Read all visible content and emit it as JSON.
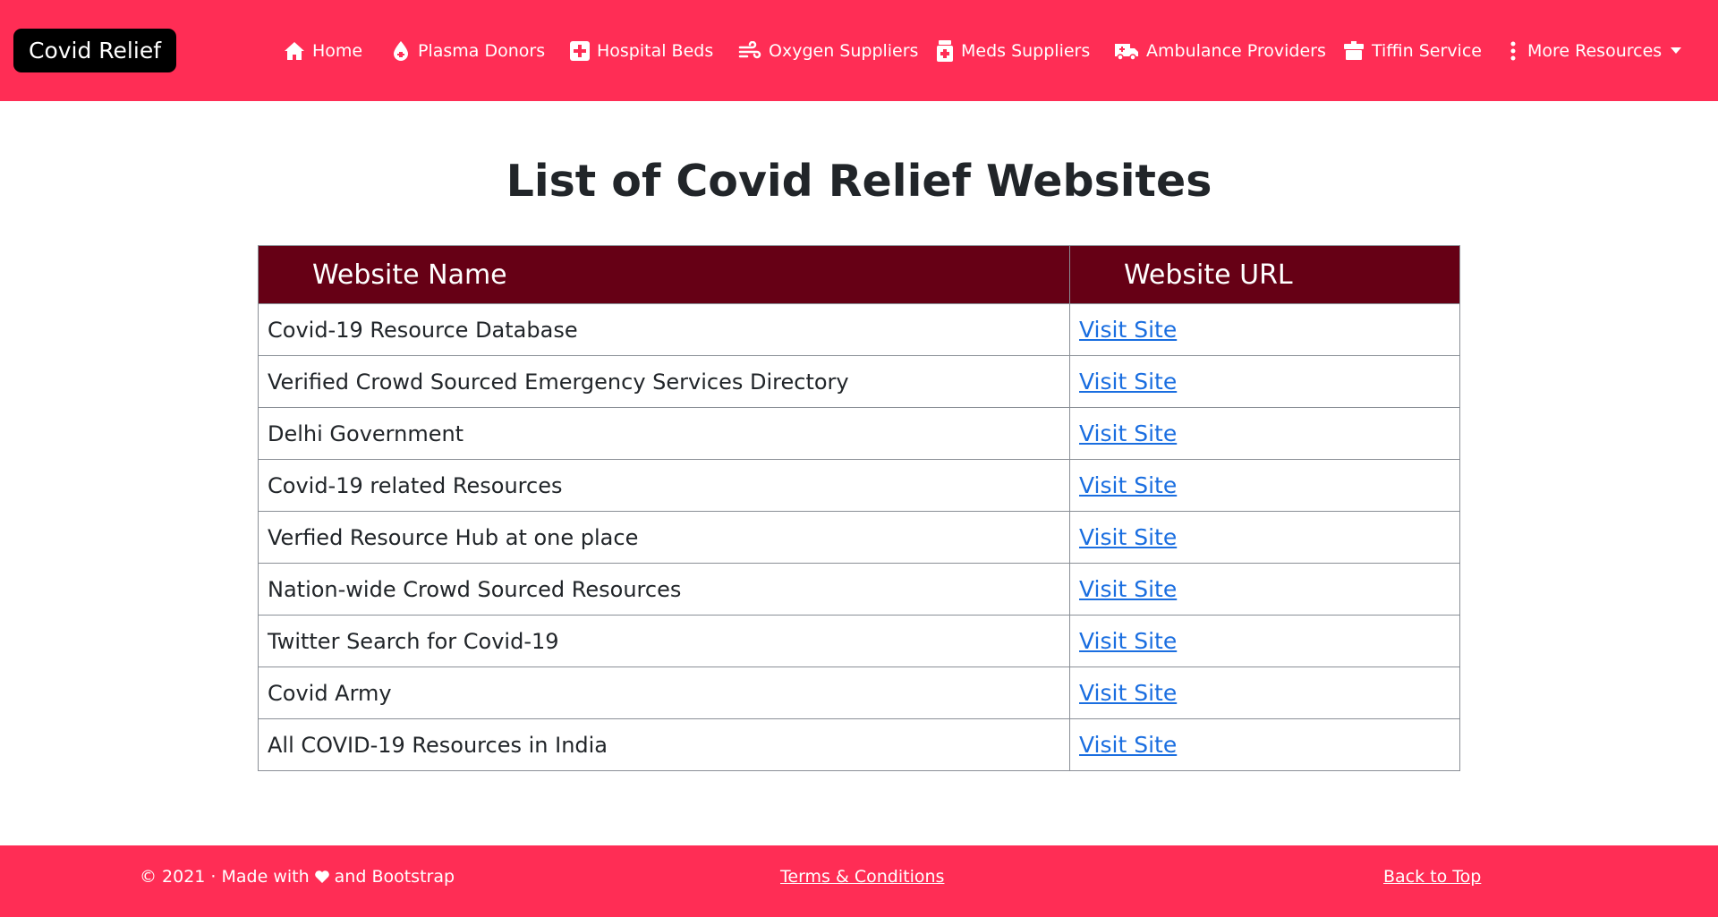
{
  "navbar": {
    "brand": "Covid Relief",
    "items": [
      {
        "label": "Home",
        "icon": "home-icon"
      },
      {
        "label": "Plasma Donors",
        "icon": "blood-drop-icon"
      },
      {
        "label": "Hospital Beds",
        "icon": "medical-cross-icon"
      },
      {
        "label": "Oxygen Suppliers",
        "icon": "wind-icon"
      },
      {
        "label": "Meds Suppliers",
        "icon": "medicine-bottle-icon"
      },
      {
        "label": "Ambulance Providers",
        "icon": "ambulance-icon"
      },
      {
        "label": "Tiffin Service",
        "icon": "tiffin-icon"
      },
      {
        "label": "More Resources",
        "icon": "vertical-dots-icon",
        "dropdown": true
      }
    ]
  },
  "main": {
    "title": "List of Covid Relief Websites",
    "table": {
      "headers": [
        "Website Name",
        "Website URL"
      ],
      "rows": [
        {
          "name": "Covid-19 Resource Database",
          "link": "Visit Site"
        },
        {
          "name": "Verified Crowd Sourced Emergency Services Directory",
          "link": "Visit Site"
        },
        {
          "name": "Delhi Government",
          "link": "Visit Site"
        },
        {
          "name": "Covid-19 related Resources",
          "link": "Visit Site"
        },
        {
          "name": "Verfied Resource Hub at one place",
          "link": "Visit Site"
        },
        {
          "name": "Nation-wide Crowd Sourced Resources",
          "link": "Visit Site"
        },
        {
          "name": "Twitter Search for Covid-19",
          "link": "Visit Site"
        },
        {
          "name": "Covid Army",
          "link": "Visit Site"
        },
        {
          "name": "All COVID-19 Resources in India",
          "link": "Visit Site"
        }
      ]
    }
  },
  "footer": {
    "copyright": "© 2021 · Made with",
    "made_with_suffix": "and Bootstrap",
    "heart_icon": "heart-icon",
    "terms": "Terms & Conditions",
    "back_to_top": "Back to Top"
  },
  "colors": {
    "primary": "#ff2d55",
    "table_header": "#660015",
    "brand_bg": "#000000",
    "link": "#1a6ee0"
  }
}
